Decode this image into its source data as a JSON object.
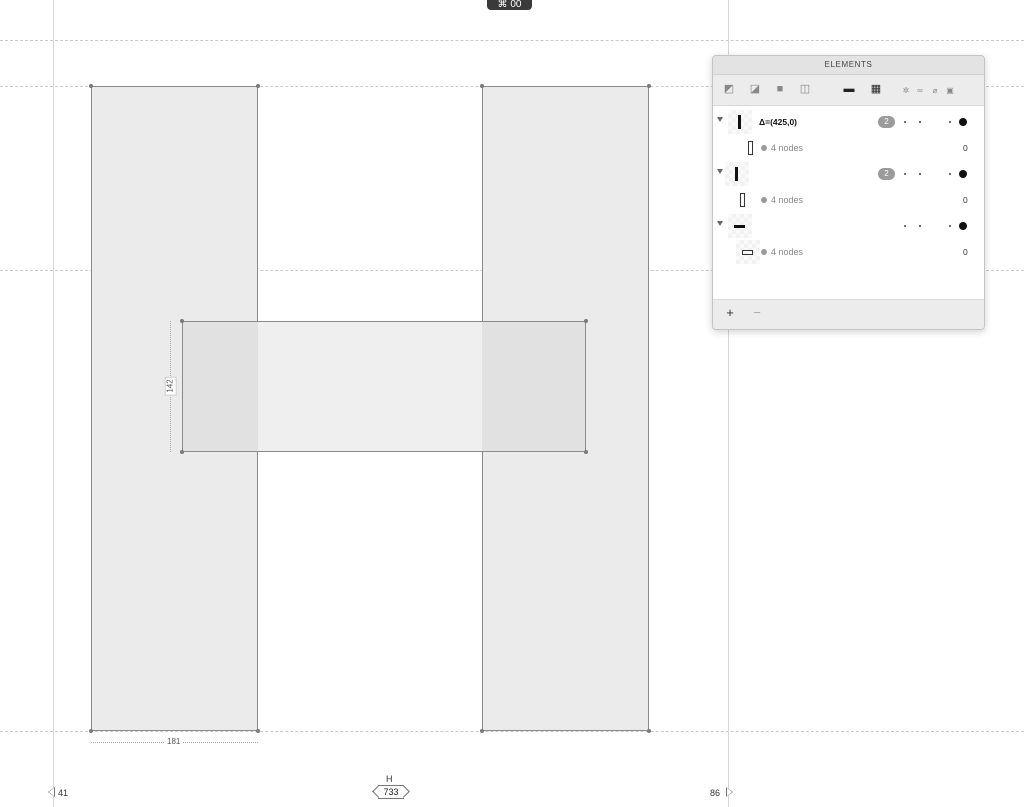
{
  "toolbar_tab": {
    "label": "⌘ 00"
  },
  "canvas": {
    "glyph_name": "H",
    "advance_width": "733",
    "left_sidebearing": "41",
    "right_sidebearing": "86",
    "stem_width_measure": "181",
    "crossbar_height_measure": "142"
  },
  "elements_panel": {
    "title": "ELEMENTS",
    "toolbar_icons": [
      "union-icon",
      "subtract-icon",
      "intersect-icon",
      "exclude-icon",
      "mask-icon",
      "grid-icon",
      "gear-icon",
      "link-icon",
      "attach-icon",
      "lock-icon"
    ],
    "rows": [
      {
        "label": "Δ=(425,0)",
        "count": "2",
        "sub_label": "4 nodes",
        "sub_value": "0"
      },
      {
        "label": "",
        "count": "2",
        "sub_label": "4 nodes",
        "sub_value": "0"
      },
      {
        "label": "",
        "count": "",
        "sub_label": "4 nodes",
        "sub_value": "0"
      }
    ],
    "footer": {
      "add_label": "+",
      "remove_label": "−"
    }
  }
}
